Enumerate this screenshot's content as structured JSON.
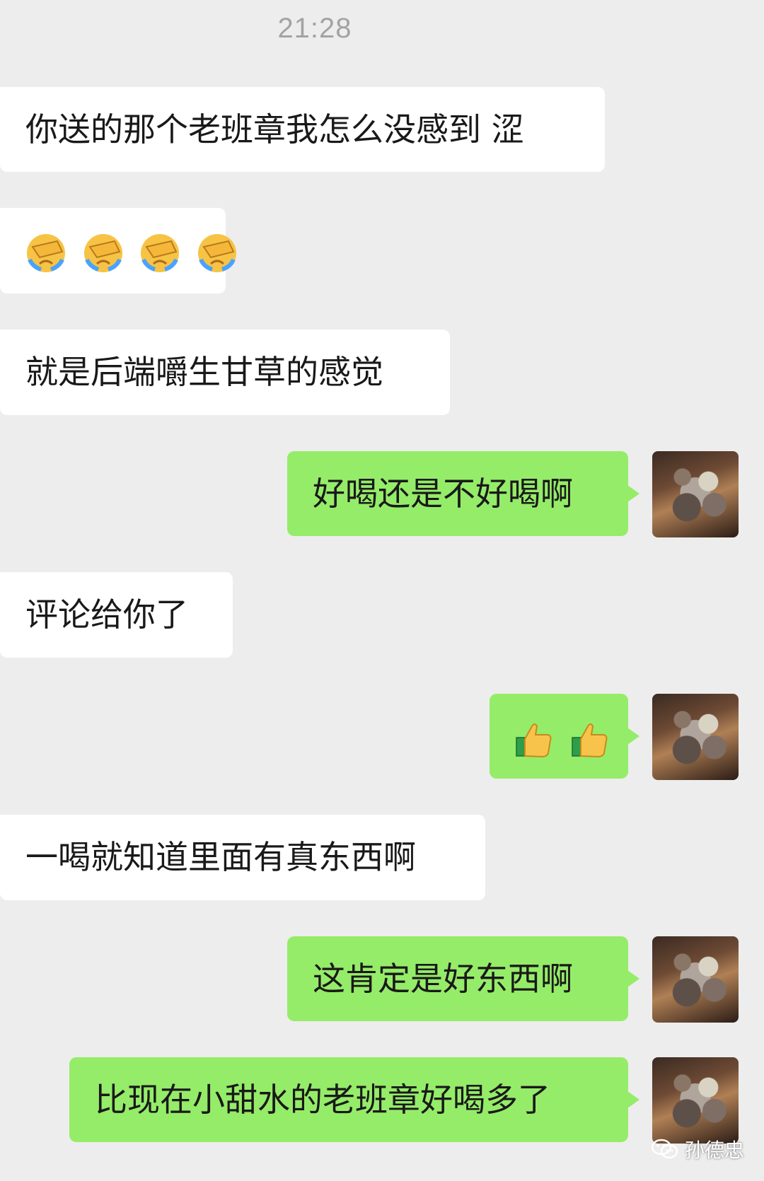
{
  "time": "21:28",
  "messages": [
    {
      "side": "in",
      "text": "你送的那个老班章我怎么没感到 涩"
    },
    {
      "side": "in",
      "emoji": [
        "facepalm-tears-emoji",
        "facepalm-tears-emoji",
        "facepalm-tears-emoji",
        "facepalm-tears-emoji"
      ]
    },
    {
      "side": "in",
      "text": "就是后端嚼生甘草的感觉"
    },
    {
      "side": "out",
      "text": "好喝还是不好喝啊"
    },
    {
      "side": "in",
      "text": "评论给你了"
    },
    {
      "side": "out",
      "emoji": [
        "thumbs-up-emoji",
        "thumbs-up-emoji"
      ]
    },
    {
      "side": "in",
      "text": "一喝就知道里面有真东西啊"
    },
    {
      "side": "out",
      "text": "这肯定是好东西啊"
    },
    {
      "side": "out",
      "text": "比现在小甜水的老班章好喝多了"
    }
  ],
  "watermark": {
    "icon": "wechat-icon",
    "text": "孙德忠"
  }
}
